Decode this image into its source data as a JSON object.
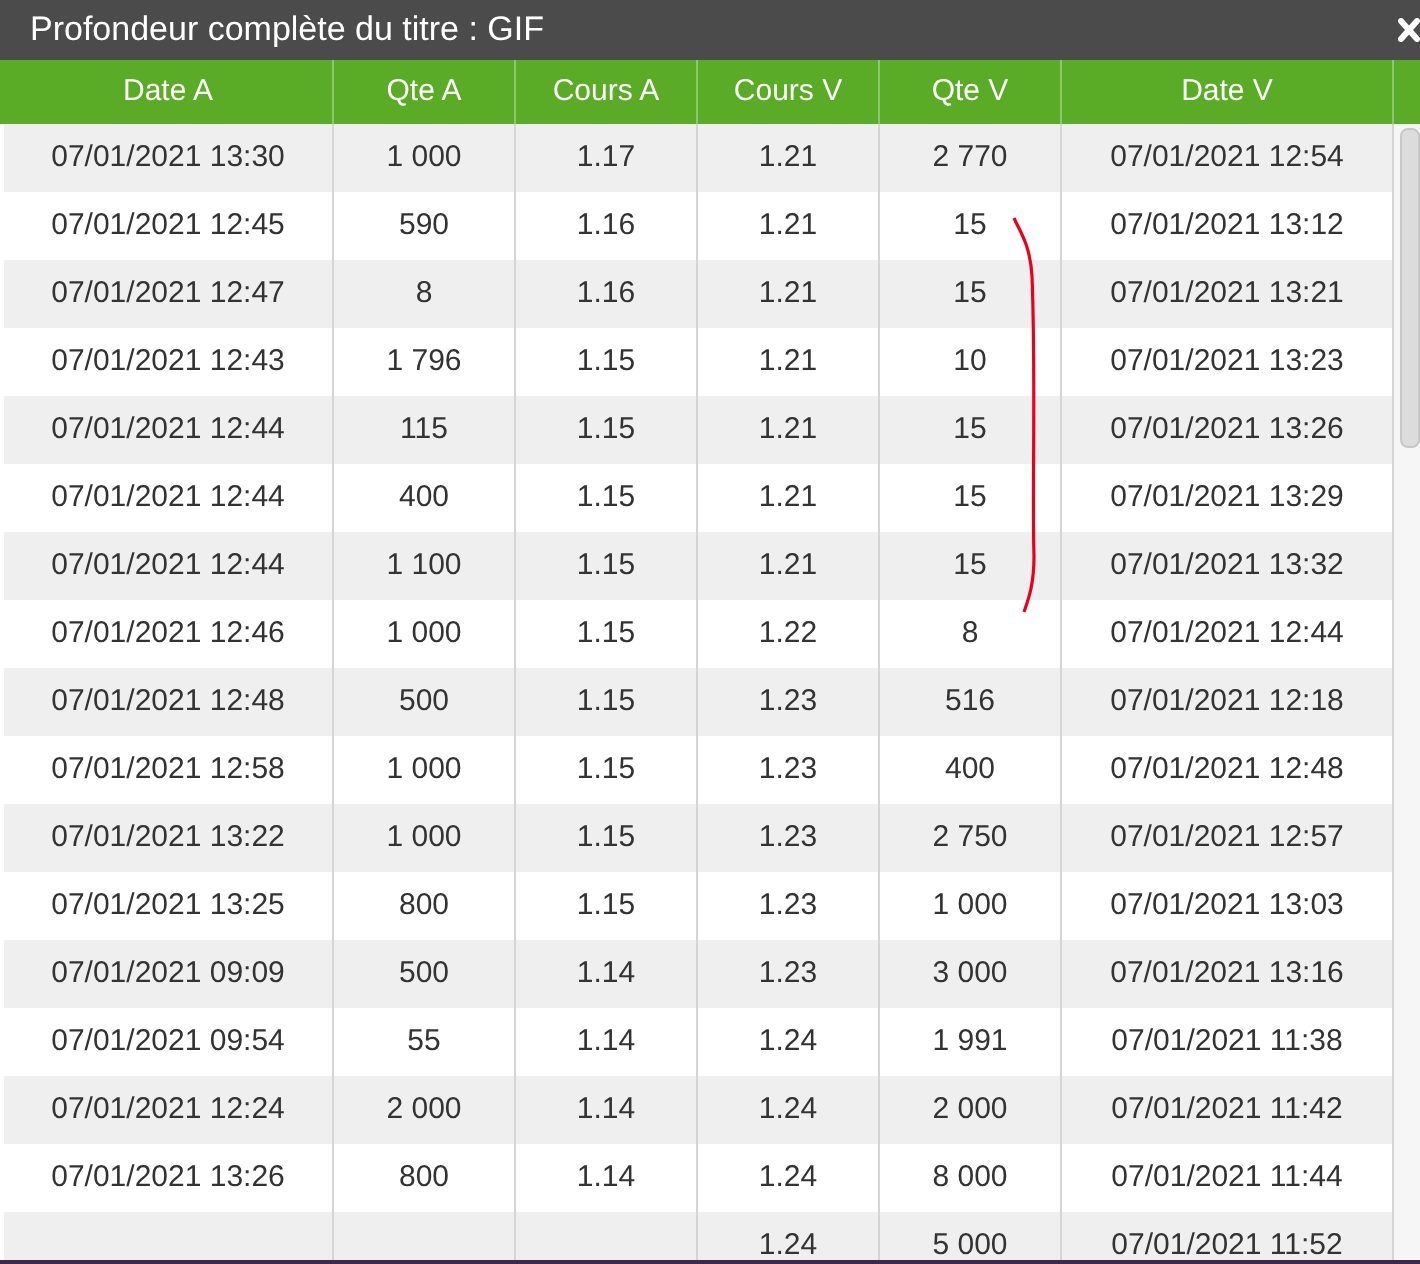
{
  "window": {
    "title": "Profondeur complète du titre : GIF"
  },
  "table": {
    "columns": [
      "Date A",
      "Qte A",
      "Cours A",
      "Cours V",
      "Qte V",
      "Date V"
    ],
    "rows": [
      [
        "07/01/2021 13:30",
        "1 000",
        "1.17",
        "1.21",
        "2 770",
        "07/01/2021 12:54"
      ],
      [
        "07/01/2021 12:45",
        "590",
        "1.16",
        "1.21",
        "15",
        "07/01/2021 13:12"
      ],
      [
        "07/01/2021 12:47",
        "8",
        "1.16",
        "1.21",
        "15",
        "07/01/2021 13:21"
      ],
      [
        "07/01/2021 12:43",
        "1 796",
        "1.15",
        "1.21",
        "10",
        "07/01/2021 13:23"
      ],
      [
        "07/01/2021 12:44",
        "115",
        "1.15",
        "1.21",
        "15",
        "07/01/2021 13:26"
      ],
      [
        "07/01/2021 12:44",
        "400",
        "1.15",
        "1.21",
        "15",
        "07/01/2021 13:29"
      ],
      [
        "07/01/2021 12:44",
        "1 100",
        "1.15",
        "1.21",
        "15",
        "07/01/2021 13:32"
      ],
      [
        "07/01/2021 12:46",
        "1 000",
        "1.15",
        "1.22",
        "8",
        "07/01/2021 12:44"
      ],
      [
        "07/01/2021 12:48",
        "500",
        "1.15",
        "1.23",
        "516",
        "07/01/2021 12:18"
      ],
      [
        "07/01/2021 12:58",
        "1 000",
        "1.15",
        "1.23",
        "400",
        "07/01/2021 12:48"
      ],
      [
        "07/01/2021 13:22",
        "1 000",
        "1.15",
        "1.23",
        "2 750",
        "07/01/2021 12:57"
      ],
      [
        "07/01/2021 13:25",
        "800",
        "1.15",
        "1.23",
        "1 000",
        "07/01/2021 13:03"
      ],
      [
        "07/01/2021 09:09",
        "500",
        "1.14",
        "1.23",
        "3 000",
        "07/01/2021 13:16"
      ],
      [
        "07/01/2021 09:54",
        "55",
        "1.14",
        "1.24",
        "1 991",
        "07/01/2021 11:38"
      ],
      [
        "07/01/2021 12:24",
        "2 000",
        "1.14",
        "1.24",
        "2 000",
        "07/01/2021 11:42"
      ],
      [
        "07/01/2021 13:26",
        "800",
        "1.14",
        "1.24",
        "8 000",
        "07/01/2021 11:44"
      ],
      [
        "",
        "",
        "",
        "1.24",
        "5 000",
        "07/01/2021 11:52"
      ]
    ]
  }
}
